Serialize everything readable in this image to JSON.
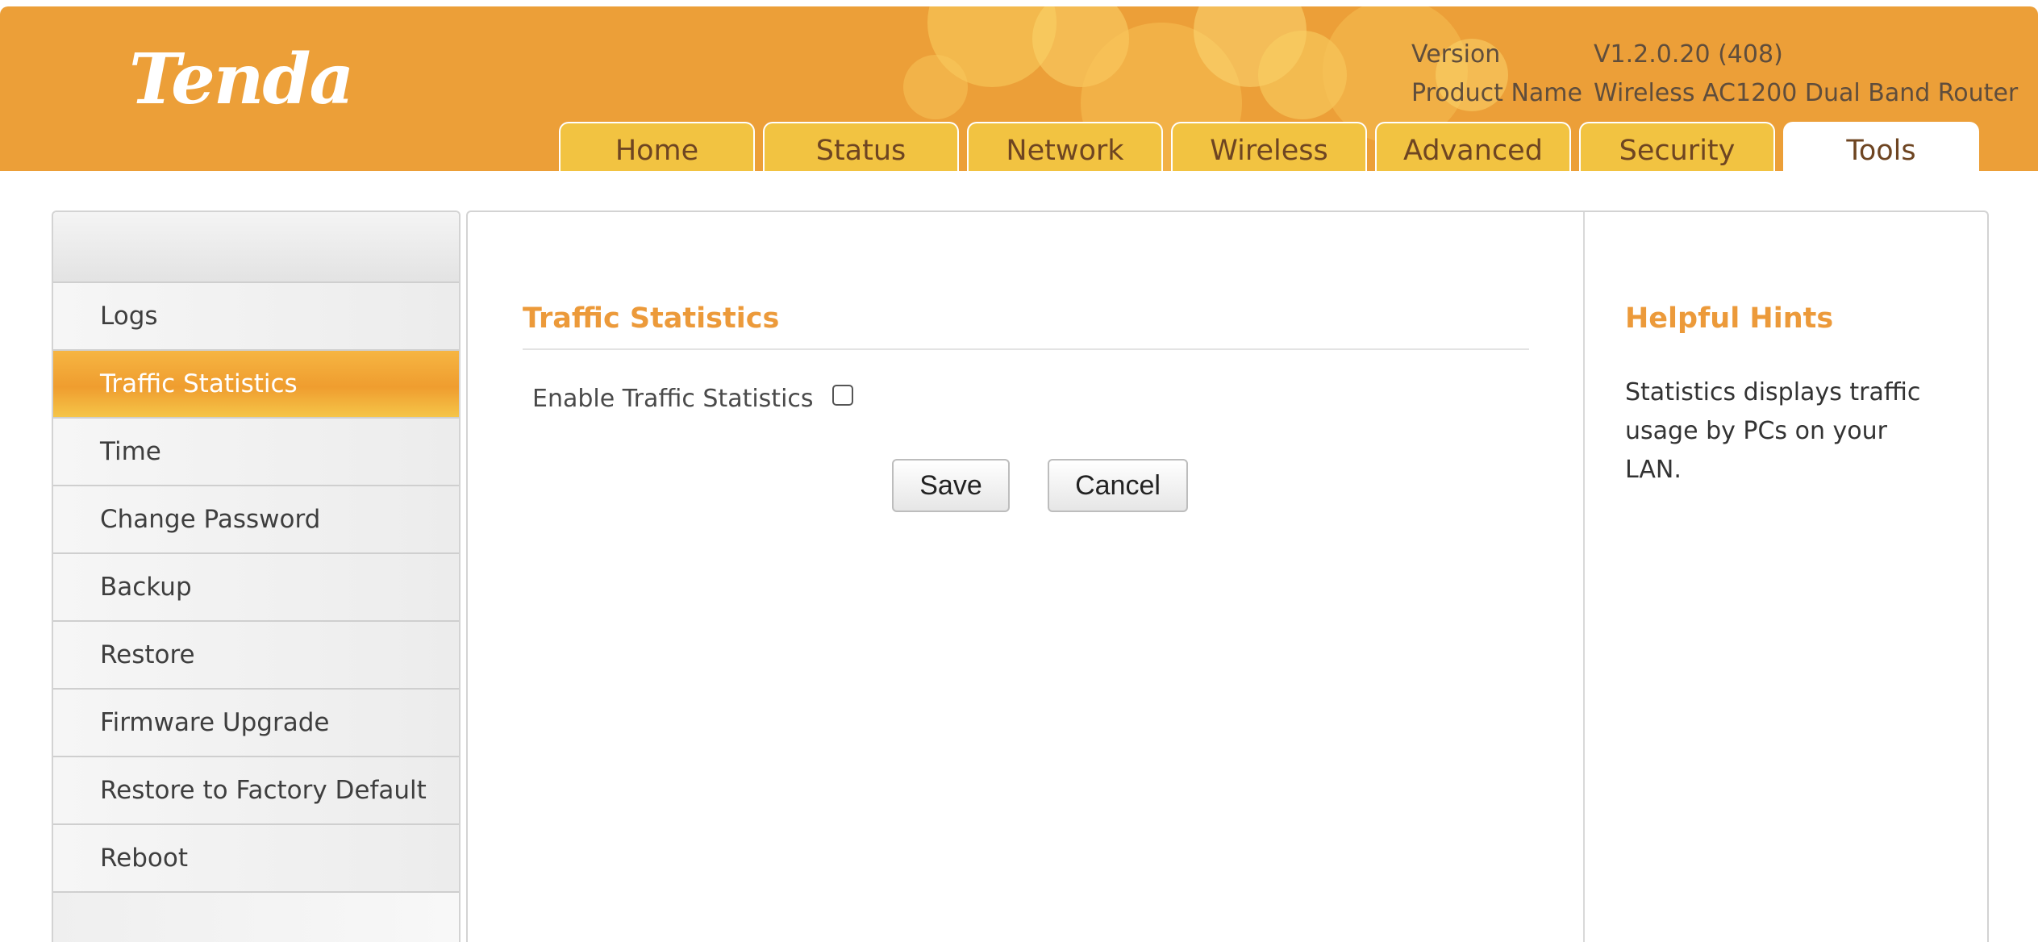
{
  "brand": {
    "logo_text": "Tenda"
  },
  "info": {
    "version_label": "Version",
    "version_value": "V1.2.0.20 (408)",
    "product_label": "Product Name",
    "product_value": "Wireless AC1200 Dual Band Router"
  },
  "nav": {
    "tabs": [
      {
        "label": "Home"
      },
      {
        "label": "Status"
      },
      {
        "label": "Network"
      },
      {
        "label": "Wireless"
      },
      {
        "label": "Advanced"
      },
      {
        "label": "Security"
      },
      {
        "label": "Tools"
      }
    ],
    "active_tab": "Tools"
  },
  "sidebar": {
    "items": [
      {
        "label": "Logs"
      },
      {
        "label": "Traffic Statistics"
      },
      {
        "label": "Time"
      },
      {
        "label": "Change Password"
      },
      {
        "label": "Backup"
      },
      {
        "label": "Restore"
      },
      {
        "label": "Firmware Upgrade"
      },
      {
        "label": "Restore to Factory Default"
      },
      {
        "label": "Reboot"
      }
    ],
    "active_item": "Traffic Statistics"
  },
  "main": {
    "title": "Traffic Statistics",
    "enable_label": "Enable Traffic Statistics",
    "enable_checked": false,
    "save_label": "Save",
    "cancel_label": "Cancel"
  },
  "hints": {
    "title": "Helpful Hints",
    "text": "Statistics displays traffic usage by PCs on your LAN."
  },
  "colors": {
    "header_bg": "#ec9f38",
    "tab_bg": "#f2c341",
    "accent_orange": "#ec9a3a"
  }
}
